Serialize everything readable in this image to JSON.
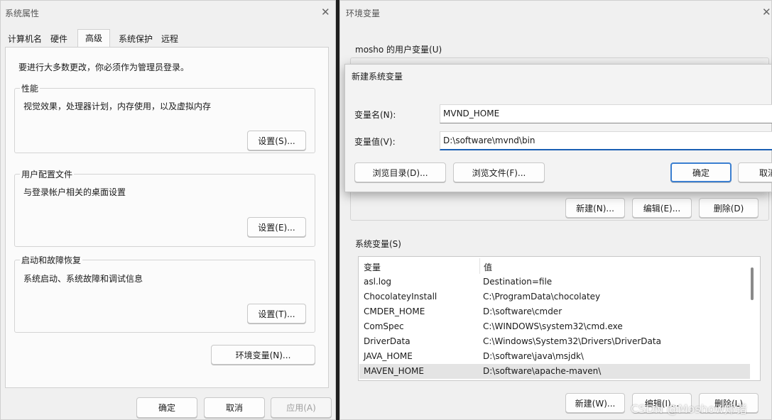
{
  "sys_props": {
    "title": "系统属性",
    "tabs": [
      "计算机名",
      "硬件",
      "高级",
      "系统保护",
      "远程"
    ],
    "admin_note": "要进行大多数更改，你必须作为管理员登录。",
    "perf": {
      "label": "性能",
      "desc": "视觉效果，处理器计划，内存使用，以及虚拟内存",
      "button": "设置(S)..."
    },
    "profile": {
      "label": "用户配置文件",
      "desc": "与登录帐户相关的桌面设置",
      "button": "设置(E)..."
    },
    "startup": {
      "label": "启动和故障恢复",
      "desc": "系统启动、系统故障和调试信息",
      "button": "设置(T)..."
    },
    "env_button": "环境变量(N)...",
    "ok": "确定",
    "cancel": "取消",
    "apply": "应用(A)"
  },
  "env_vars": {
    "title": "环境变量",
    "user_section": "mosho 的用户变量(U)",
    "user_buttons": {
      "new": "新建(N)...",
      "edit": "编辑(E)...",
      "delete": "删除(D)"
    },
    "sys_section": "系统变量(S)",
    "columns": {
      "var": "变量",
      "val": "值"
    },
    "rows": [
      {
        "name": "asl.log",
        "value": "Destination=file"
      },
      {
        "name": "ChocolateyInstall",
        "value": "C:\\ProgramData\\chocolatey"
      },
      {
        "name": "CMDER_HOME",
        "value": "D:\\software\\cmder"
      },
      {
        "name": "ComSpec",
        "value": "C:\\WINDOWS\\system32\\cmd.exe"
      },
      {
        "name": "DriverData",
        "value": "C:\\Windows\\System32\\Drivers\\DriverData"
      },
      {
        "name": "JAVA_HOME",
        "value": "D:\\software\\java\\msjdk\\"
      },
      {
        "name": "MAVEN_HOME",
        "value": "D:\\software\\apache-maven\\"
      }
    ],
    "sys_buttons": {
      "new": "新建(W)...",
      "edit": "编辑(I)...",
      "delete": "删除(L)"
    }
  },
  "new_var": {
    "title": "新建系统变量",
    "name_label": "变量名(N):",
    "name_value": "MVND_HOME",
    "value_label": "变量值(V):",
    "value_value": "D:\\software\\mvnd\\bin",
    "browse_dir": "浏览目录(D)...",
    "browse_file": "浏览文件(F)...",
    "ok": "确定",
    "cancel": "取消"
  },
  "watermark": "CSDN @Moshow郑锴"
}
